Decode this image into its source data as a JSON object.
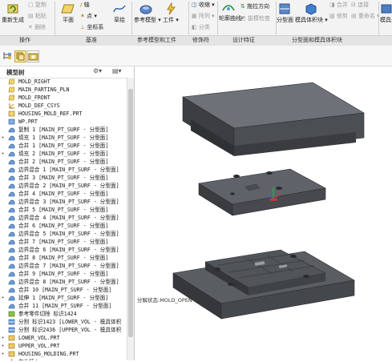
{
  "ribbon": {
    "ops": {
      "regen": "重新生成",
      "copy": "复制",
      "paste": "粘贴",
      "delete": "删除"
    },
    "datum": {
      "plane": "平面",
      "axis": "轴",
      "point": "点",
      "csys": "坐标系",
      "sketch": "草绘"
    },
    "ref": {
      "ref_model": "参考模型",
      "workpiece": "工件"
    },
    "modify": {
      "shrink": "收缩",
      "array": "阵列",
      "split": "分类"
    },
    "design": {
      "contour_curve": "轮廓曲线",
      "drag_dir": "拖拉方向",
      "draft_check": "拔模检查"
    },
    "parting": {
      "parting_surface": "分型面",
      "mold_volume": "模具体积块",
      "merge": "合并",
      "trim": "修剪",
      "link": "连接",
      "rename": "重命名"
    },
    "mold_comp": {
      "label": "模具元件"
    },
    "groups": {
      "ops": "操作",
      "datum": "基准",
      "ref_parts": "参考模型和工件",
      "modifiers": "修饰符",
      "design_features": "设计特征",
      "parting": "分型面和模具体积块"
    }
  },
  "panel": {
    "title": "模型树"
  },
  "tree": [
    {
      "label": "MOLD_RIGHT",
      "icon": "datum-plane-icon",
      "exp": ""
    },
    {
      "label": "MAIN_PARTING_PLN",
      "icon": "datum-plane-icon",
      "exp": ""
    },
    {
      "label": "MOLD_FRONT",
      "icon": "datum-plane-icon",
      "exp": ""
    },
    {
      "label": "MOLD_DEF_CSYS",
      "icon": "csys-icon",
      "exp": ""
    },
    {
      "label": "HOUSING_MOLD_REF.PRT",
      "icon": "ref-part-icon",
      "exp": ""
    },
    {
      "label": "WP.PRT",
      "icon": "workpiece-icon",
      "exp": ""
    },
    {
      "label": "复制 1 [MAIN_PT_SURF - 分型面]",
      "icon": "surface-icon",
      "exp": ""
    },
    {
      "label": "填充 1 [MAIN_PT_SURF - 分型面]",
      "icon": "surface-icon",
      "exp": "▸"
    },
    {
      "label": "合并 1 [MAIN_PT_SURF - 分型面]",
      "icon": "surface-icon",
      "exp": ""
    },
    {
      "label": "填充 2 [MAIN_PT_SURF - 分型面]",
      "icon": "surface-icon",
      "exp": "▸"
    },
    {
      "label": "合并 2 [MAIN_PT_SURF - 分型面]",
      "icon": "surface-icon",
      "exp": ""
    },
    {
      "label": "边界混合 1 [MAIN_PT_SURF - 分型面]",
      "icon": "surface-icon",
      "exp": ""
    },
    {
      "label": "合并 3 [MAIN_PT_SURF - 分型面]",
      "icon": "surface-icon",
      "exp": ""
    },
    {
      "label": "边界混合 2 [MAIN_PT_SURF - 分型面]",
      "icon": "surface-icon",
      "exp": ""
    },
    {
      "label": "合并 4 [MAIN_PT_SURF - 分型面]",
      "icon": "surface-icon",
      "exp": ""
    },
    {
      "label": "边界混合 3 [MAIN_PT_SURF - 分型面]",
      "icon": "surface-icon",
      "exp": ""
    },
    {
      "label": "合并 5 [MAIN_PT_SURF - 分型面]",
      "icon": "surface-icon",
      "exp": ""
    },
    {
      "label": "边界混合 4 [MAIN_PT_SURF - 分型面]",
      "icon": "surface-icon",
      "exp": ""
    },
    {
      "label": "合并 6 [MAIN_PT_SURF - 分型面]",
      "icon": "surface-icon",
      "exp": ""
    },
    {
      "label": "边界混合 5 [MAIN_PT_SURF - 分型面]",
      "icon": "surface-icon",
      "exp": ""
    },
    {
      "label": "合并 7 [MAIN_PT_SURF - 分型面]",
      "icon": "surface-icon",
      "exp": ""
    },
    {
      "label": "边界混合 6 [MAIN_PT_SURF - 分型面]",
      "icon": "surface-icon",
      "exp": ""
    },
    {
      "label": "合并 8 [MAIN_PT_SURF - 分型面]",
      "icon": "surface-icon",
      "exp": ""
    },
    {
      "label": "边界混合 7 [MAIN_PT_SURF - 分型面]",
      "icon": "surface-icon",
      "exp": ""
    },
    {
      "label": "合并 9 [MAIN_PT_SURF - 分型面]",
      "icon": "surface-icon",
      "exp": ""
    },
    {
      "label": "边界混合 8 [MAIN_PT_SURF - 分型面]",
      "icon": "surface-icon",
      "exp": ""
    },
    {
      "label": "合并 10 [MAIN_PT_SURF - 分型面]",
      "icon": "surface-icon",
      "exp": ""
    },
    {
      "label": "延伸 1 [MAIN_PT_SURF - 分型面]",
      "icon": "surface-icon",
      "exp": "▸"
    },
    {
      "label": "合并 11 [MAIN_PT_SURF - 分型面]",
      "icon": "surface-icon",
      "exp": ""
    },
    {
      "label": "参考零件切除 标识1424",
      "icon": "cut-icon",
      "exp": ""
    },
    {
      "label": "分割 标识1423 [LOWER_VOL - 模具体积",
      "icon": "split-icon",
      "exp": ""
    },
    {
      "label": "分割 标识2436 [UPPER_VOL - 模具体积",
      "icon": "split-icon",
      "exp": ""
    },
    {
      "label": "LOWER_VOL.PRT",
      "icon": "part-icon",
      "exp": "▸"
    },
    {
      "label": "UPPER_VOL.PRT",
      "icon": "part-icon",
      "exp": "▸"
    },
    {
      "label": "HOUSING_MOLDING.PRT",
      "icon": "part-icon",
      "exp": "▸"
    },
    {
      "label": "在此插入",
      "icon": "insert-here-icon",
      "exp": ""
    }
  ],
  "viewport": {
    "caption": "分解状态:MOLD_OPEN"
  },
  "colors": {
    "mold_dark": "#4a4d52",
    "mold_top": "#6b6f75",
    "mold_side": "#383a3e",
    "selection": "#fbe9a6"
  }
}
